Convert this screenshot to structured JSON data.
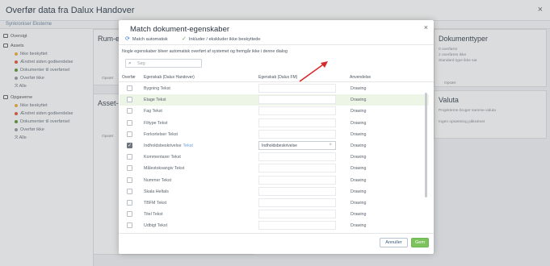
{
  "window": {
    "title": "Overfør data fra Dalux Handover",
    "close": "×"
  },
  "subbar": {
    "label": "Synkroniser Eksterne"
  },
  "left_nav": [
    {
      "label": "Oversigt",
      "kind": "head"
    },
    {
      "label": "Assets",
      "kind": "head"
    },
    {
      "label": "Ikke beskyttet",
      "kind": "sub",
      "color": "#f0b040"
    },
    {
      "label": "Ændret siden godkendelse",
      "kind": "sub",
      "color": "#e0583c"
    },
    {
      "label": "Dokumenter til overførsel",
      "kind": "sub",
      "color": "#5a9a3a"
    },
    {
      "label": "Overfør ikke",
      "kind": "sub",
      "color": "#9aa0a6"
    },
    {
      "label": "Alle",
      "kind": "sub",
      "color": ""
    },
    {
      "label": "Opgaverne",
      "kind": "head"
    },
    {
      "label": "Ikke beskyttet",
      "kind": "sub",
      "color": "#f0b040"
    },
    {
      "label": "Ændret siden godkendelse",
      "kind": "sub",
      "color": "#e0583c"
    },
    {
      "label": "Dokumenter til overførsel",
      "kind": "sub",
      "color": "#5a9a3a"
    },
    {
      "label": "Overfør ikke",
      "kind": "sub",
      "color": "#9aa0a6"
    },
    {
      "label": "Alle",
      "kind": "sub",
      "color": ""
    }
  ],
  "background": {
    "rum_title": "Rum-e",
    "asset_title": "Asset-e",
    "dokumenttyper": {
      "title": "Dokumenttyper",
      "lines": [
        "0 overførst",
        "2 overføres ikke",
        "Standard type ikke sat"
      ],
      "link": "Opsæt"
    },
    "valuta": {
      "title": "Valuta",
      "lines": [
        "Projekterne bruger samme valuta",
        "Ingen opsætning påkrævet"
      ]
    },
    "opsaet_a": "Opsæt",
    "opsaet_b": "Opsæt"
  },
  "dialog": {
    "title": "Match dokument-egenskaber",
    "close": "×",
    "toolbar": {
      "auto_match": "Match automatisk",
      "include_exclude": "Inkluder / ekskluder ikke beskyttede"
    },
    "info": "Nogle egenskaber bliver automatisk overført af systemet og fremgår ikke i denne dialog",
    "search_placeholder": "Søg",
    "columns": {
      "overfor": "Overfør",
      "egenskab": "Egenskab (Dalux Handover)",
      "egenskab_fm": "Egenskab (Dalux FM)",
      "anvendelse": "Anvendelse"
    },
    "rows": [
      {
        "name": "Bygning Tekst",
        "tag": "",
        "checked": false,
        "selected": false,
        "fm_value": "",
        "usage": "Drawing"
      },
      {
        "name": "Etage Tekst",
        "tag": "",
        "checked": false,
        "selected": true,
        "fm_value": "",
        "usage": "Drawing"
      },
      {
        "name": "Fag Tekst",
        "tag": "",
        "checked": false,
        "selected": false,
        "fm_value": "",
        "usage": "Drawing"
      },
      {
        "name": "Filtype Tekst",
        "tag": "",
        "checked": false,
        "selected": false,
        "fm_value": "",
        "usage": "Drawing"
      },
      {
        "name": "Forkortelser Tekst",
        "tag": "",
        "checked": false,
        "selected": false,
        "fm_value": "",
        "usage": "Drawing"
      },
      {
        "name": "Indholdsbeskrivelse",
        "tag": "Tekst",
        "checked": true,
        "selected": false,
        "fm_value": "Indholdsbeskrivelse",
        "usage": "Drawing"
      },
      {
        "name": "Kommentarer Tekst",
        "tag": "",
        "checked": false,
        "selected": false,
        "fm_value": "",
        "usage": "Drawing"
      },
      {
        "name": "Målestoksangiv Tekst",
        "tag": "",
        "checked": false,
        "selected": false,
        "fm_value": "",
        "usage": "Drawing"
      },
      {
        "name": "Nummer Tekst",
        "tag": "",
        "checked": false,
        "selected": false,
        "fm_value": "",
        "usage": "Drawing"
      },
      {
        "name": "Skala Heltals",
        "tag": "",
        "checked": false,
        "selected": false,
        "fm_value": "",
        "usage": "Drawing"
      },
      {
        "name": "TBFM Tekst",
        "tag": "",
        "checked": false,
        "selected": false,
        "fm_value": "",
        "usage": "Drawing"
      },
      {
        "name": "Titel Tekst",
        "tag": "",
        "checked": false,
        "selected": false,
        "fm_value": "",
        "usage": "Drawing"
      },
      {
        "name": "Udbigt Tekst",
        "tag": "",
        "checked": false,
        "selected": false,
        "fm_value": "",
        "usage": "Drawing"
      }
    ],
    "cancel": "Annuller",
    "ok": "Gem"
  },
  "colors": {
    "accent_green": "#7cc35e",
    "arrow_red": "#d62a2a",
    "link_blue": "#3a7bd5"
  }
}
